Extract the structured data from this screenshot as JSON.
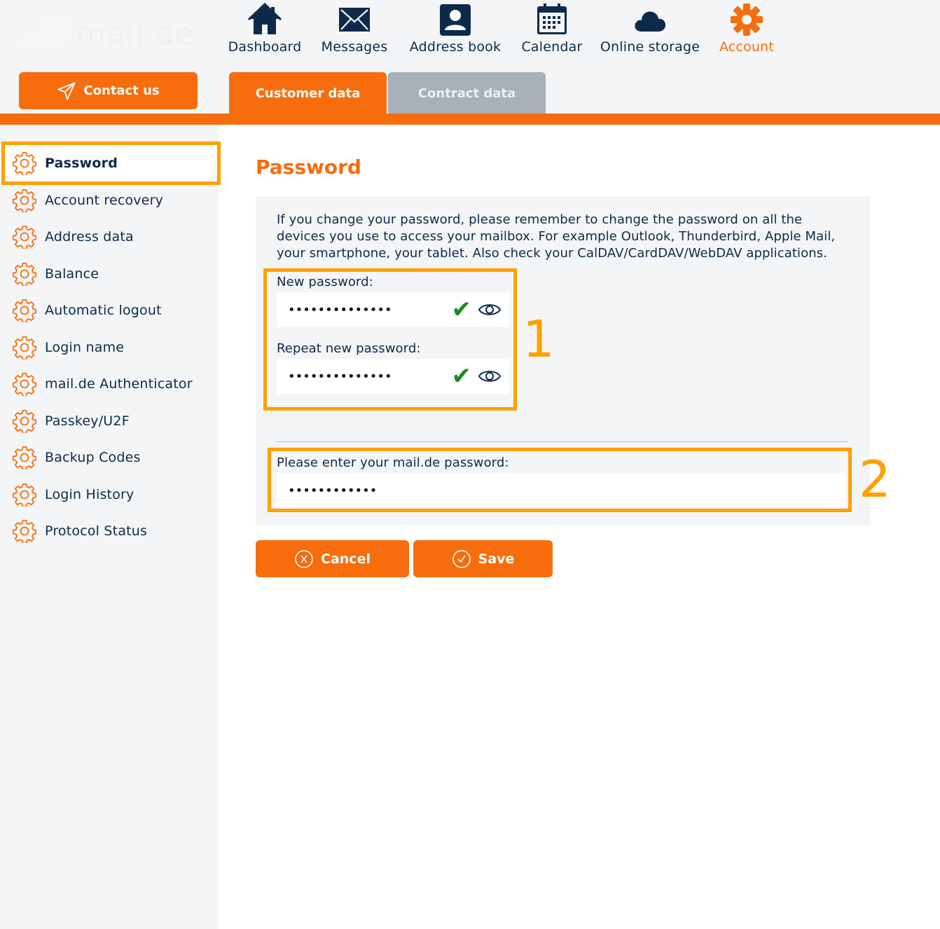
{
  "brand": {
    "logo_text": "mail.de"
  },
  "colors": {
    "accent": "#f76d0d",
    "navy": "#0d2a4a",
    "highlight": "#ffa000",
    "valid": "#1f8a1f",
    "tab_inactive": "#a8b0ba"
  },
  "contact_button": {
    "label": "Contact us",
    "icon": "paper-plane-icon"
  },
  "nav": [
    {
      "label": "Dashboard",
      "icon": "home-icon"
    },
    {
      "label": "Messages",
      "icon": "envelope-icon"
    },
    {
      "label": "Address book",
      "icon": "contact-card-icon"
    },
    {
      "label": "Calendar",
      "icon": "calendar-icon"
    },
    {
      "label": "Online storage",
      "icon": "cloud-icon"
    },
    {
      "label": "Account",
      "icon": "gear-icon",
      "active": true
    }
  ],
  "tabs": [
    {
      "label": "Customer data",
      "active": true
    },
    {
      "label": "Contract data",
      "active": false
    }
  ],
  "sidebar": {
    "items": [
      {
        "label": "Password",
        "active": true
      },
      {
        "label": "Account recovery"
      },
      {
        "label": "Address data"
      },
      {
        "label": "Balance"
      },
      {
        "label": "Automatic logout"
      },
      {
        "label": "Login name"
      },
      {
        "label": "mail.de Authenticator"
      },
      {
        "label": "Passkey/U2F"
      },
      {
        "label": "Backup Codes"
      },
      {
        "label": "Login History"
      },
      {
        "label": "Protocol Status"
      }
    ]
  },
  "main": {
    "title": "Password",
    "info_text": "If you change your password, please remember to change the password on all the devices you use to access your mailbox. For example Outlook, Thunderbird, Apple Mail, your smartphone, your tablet. Also check your CalDAV/CardDAV/WebDAV applications.",
    "new_password": {
      "label": "New password:",
      "value": "••••••••••••••",
      "valid": true
    },
    "repeat_password": {
      "label": "Repeat new password:",
      "value": "••••••••••••••",
      "valid": true
    },
    "current_password": {
      "label": "Please enter your mail.de password:",
      "value": "••••••••••••"
    },
    "check_mark": "✔",
    "annotations": {
      "box_1": "1",
      "box_2": "2"
    },
    "buttons": {
      "cancel": "Cancel",
      "save": "Save"
    }
  }
}
